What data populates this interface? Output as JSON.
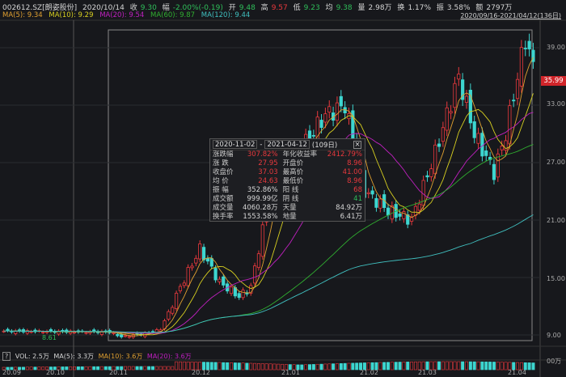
{
  "header": {
    "symbol": "002612.SZ[朗姿股份]",
    "date": "2020/10/14",
    "close_label": "收",
    "close": "9.30",
    "chg_label": "幅",
    "chg": "-2.00%(-0.19)",
    "open_label": "开",
    "open": "9.48",
    "high_label": "高",
    "high": "9.57",
    "low_label": "低",
    "low": "9.23",
    "avg_label": "均",
    "avg": "9.38",
    "vol_label": "量",
    "vol": "2.98万",
    "turn_label": "换",
    "turn": "1.17%",
    "amp_label": "振",
    "amp": "3.58%",
    "amt_label": "额",
    "amt": "2797万"
  },
  "ma": {
    "ma5": "MA(5): 9.34",
    "ma10": "MA(10): 9.29",
    "ma20": "MA(20): 9.54",
    "ma60": "MA(60): 9.87",
    "ma120": "MA(120): 9.44"
  },
  "range_label": "2020/09/16-2021/04/12(136日)",
  "price_tag": "35.99",
  "low_marker": "8.61",
  "y_labels": [
    "39.00",
    "33.00",
    "27.00",
    "21.00",
    "15.00",
    "9.00"
  ],
  "x_labels": [
    "20.09",
    "20.10",
    "20.11",
    "20.12",
    "21.01",
    "21.02",
    "21.03",
    "21.04"
  ],
  "volume": {
    "help": "?",
    "vol": "VOL: 2.5万",
    "ma5": "MA(5): 3.3万",
    "ma10": "MA(10): 3.6万",
    "ma20": "MA(20): 3.6万",
    "axis": "00万"
  },
  "popup": {
    "start": "2020-11-02",
    "sep": "-",
    "end": "2021-04-12",
    "days": "(109日)",
    "rows": [
      [
        "涨跌幅",
        "307.82%",
        "年化收益率",
        "2412.79%"
      ],
      [
        "涨 跌",
        "27.95",
        "开盘价",
        "8.96"
      ],
      [
        "收盘价",
        "37.03",
        "最高价",
        "41.00"
      ],
      [
        "均 价",
        "24.63",
        "最低价",
        "8.96"
      ],
      [
        "振 幅",
        "352.86%",
        "阳 线",
        "68"
      ],
      [
        "成交额",
        "999.99亿",
        "阴 线",
        "41"
      ],
      [
        "成交量",
        "4060.28万",
        "天量",
        "84.92万"
      ],
      [
        "换手率",
        "1553.58%",
        "地量",
        "6.41万"
      ]
    ]
  },
  "colors": {
    "up": "#e8393d",
    "down": "#3dd6d0",
    "ma5": "#e0a030",
    "ma10": "#d8d020",
    "ma20": "#c020c0",
    "ma60": "#30b030",
    "ma120": "#40c0c0"
  },
  "chart_data": {
    "type": "candlestick",
    "count": 136,
    "keypoints": [
      [
        0,
        9.4
      ],
      [
        27,
        9.3
      ],
      [
        30,
        8.8
      ],
      [
        37,
        9.2
      ],
      [
        40,
        9.6
      ],
      [
        45,
        14
      ],
      [
        50,
        18
      ],
      [
        55,
        14.5
      ],
      [
        60,
        13
      ],
      [
        63,
        14
      ],
      [
        67,
        22
      ],
      [
        70,
        27
      ],
      [
        75,
        28
      ],
      [
        82,
        32
      ],
      [
        87,
        33
      ],
      [
        92,
        24
      ],
      [
        98,
        22
      ],
      [
        104,
        21
      ],
      [
        110,
        28
      ],
      [
        116,
        36
      ],
      [
        120,
        30
      ],
      [
        125,
        26
      ],
      [
        128,
        30
      ],
      [
        133,
        40
      ],
      [
        135,
        37
      ]
    ],
    "ylim": [
      8,
      42
    ]
  }
}
